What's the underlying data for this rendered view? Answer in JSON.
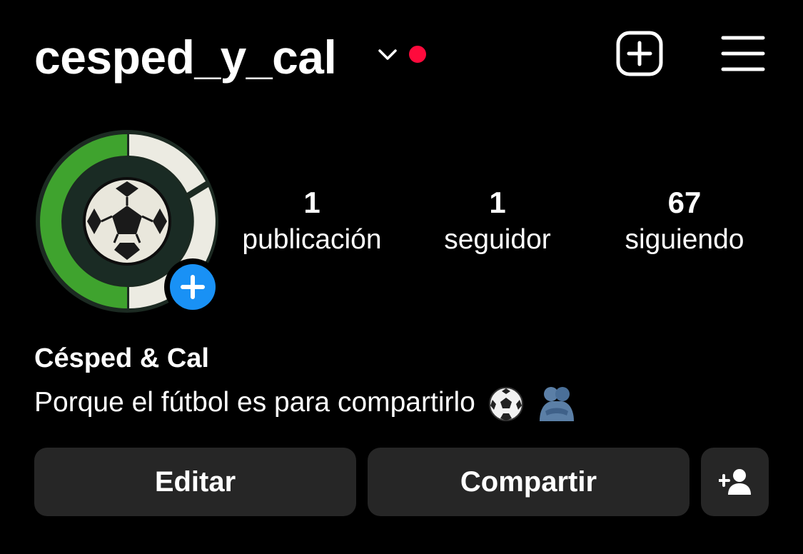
{
  "header": {
    "username": "cesped_y_cal",
    "icons": {
      "switch_account": "chevron-down-icon",
      "notification": "red-dot-icon",
      "new_post": "plus-square-icon",
      "menu": "hamburger-menu-icon"
    },
    "colors": {
      "notification_dot": "#ff0a3c"
    }
  },
  "profile": {
    "avatar_icon": "soccer-ball-logo",
    "add_story_icon": "plus-circle-icon",
    "colors": {
      "add_story": "#1991f5"
    },
    "stats": [
      {
        "value": "1",
        "label": "publicación"
      },
      {
        "value": "1",
        "label": "seguidor"
      },
      {
        "value": "67",
        "label": "siguiendo"
      }
    ],
    "display_name": "Césped & Cal",
    "bio": "Porque el fútbol es para compartirlo",
    "bio_emojis": [
      "soccer-ball-emoji",
      "people-hugging-emoji"
    ]
  },
  "actions": {
    "edit_label": "Editar",
    "share_label": "Compartir",
    "discover_people_icon": "add-person-icon",
    "colors": {
      "button_bg": "#262626"
    }
  }
}
